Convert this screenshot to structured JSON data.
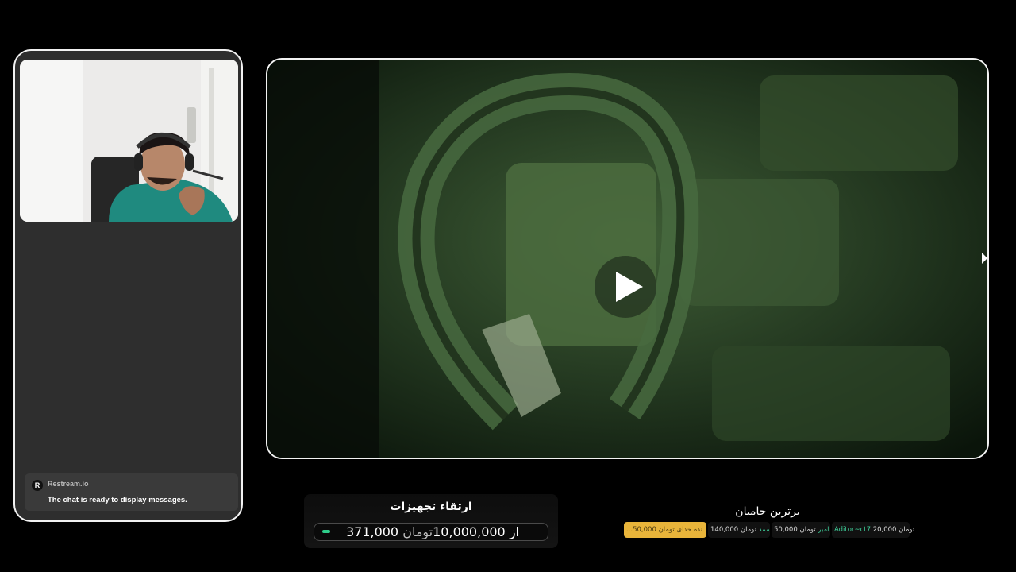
{
  "chat": {
    "logo": "R",
    "source": "Restream.io",
    "message": "The chat is ready to display messages."
  },
  "goal": {
    "title": "ارتقاء تجهیزات",
    "current": "371,000",
    "connector": "از",
    "target": "10,000,000",
    "unit": "تومان",
    "progress_fraction": 0.0371
  },
  "sponsors": {
    "title": "برترین حامیان",
    "items": [
      {
        "amount": "20,000",
        "unit": "تومان",
        "name": "Aditor~ct7"
      },
      {
        "amount": "50,000",
        "unit": "تومان",
        "name": "امیر"
      },
      {
        "amount": "140,000",
        "unit": "تومان",
        "name": "ممد"
      },
      {
        "amount": "50,000",
        "unit": "تومان",
        "name": "...نده خدای"
      }
    ]
  },
  "icons": {
    "play": "play-icon",
    "cursor": "mouse-cursor-icon"
  },
  "colors": {
    "background": "#000000",
    "panel": "#2e2e2e",
    "frame_border": "#f2f2f2",
    "progress": "#2ecc8a",
    "gold": "#e8b43a",
    "sponsor_name": "#3fcf9a"
  }
}
